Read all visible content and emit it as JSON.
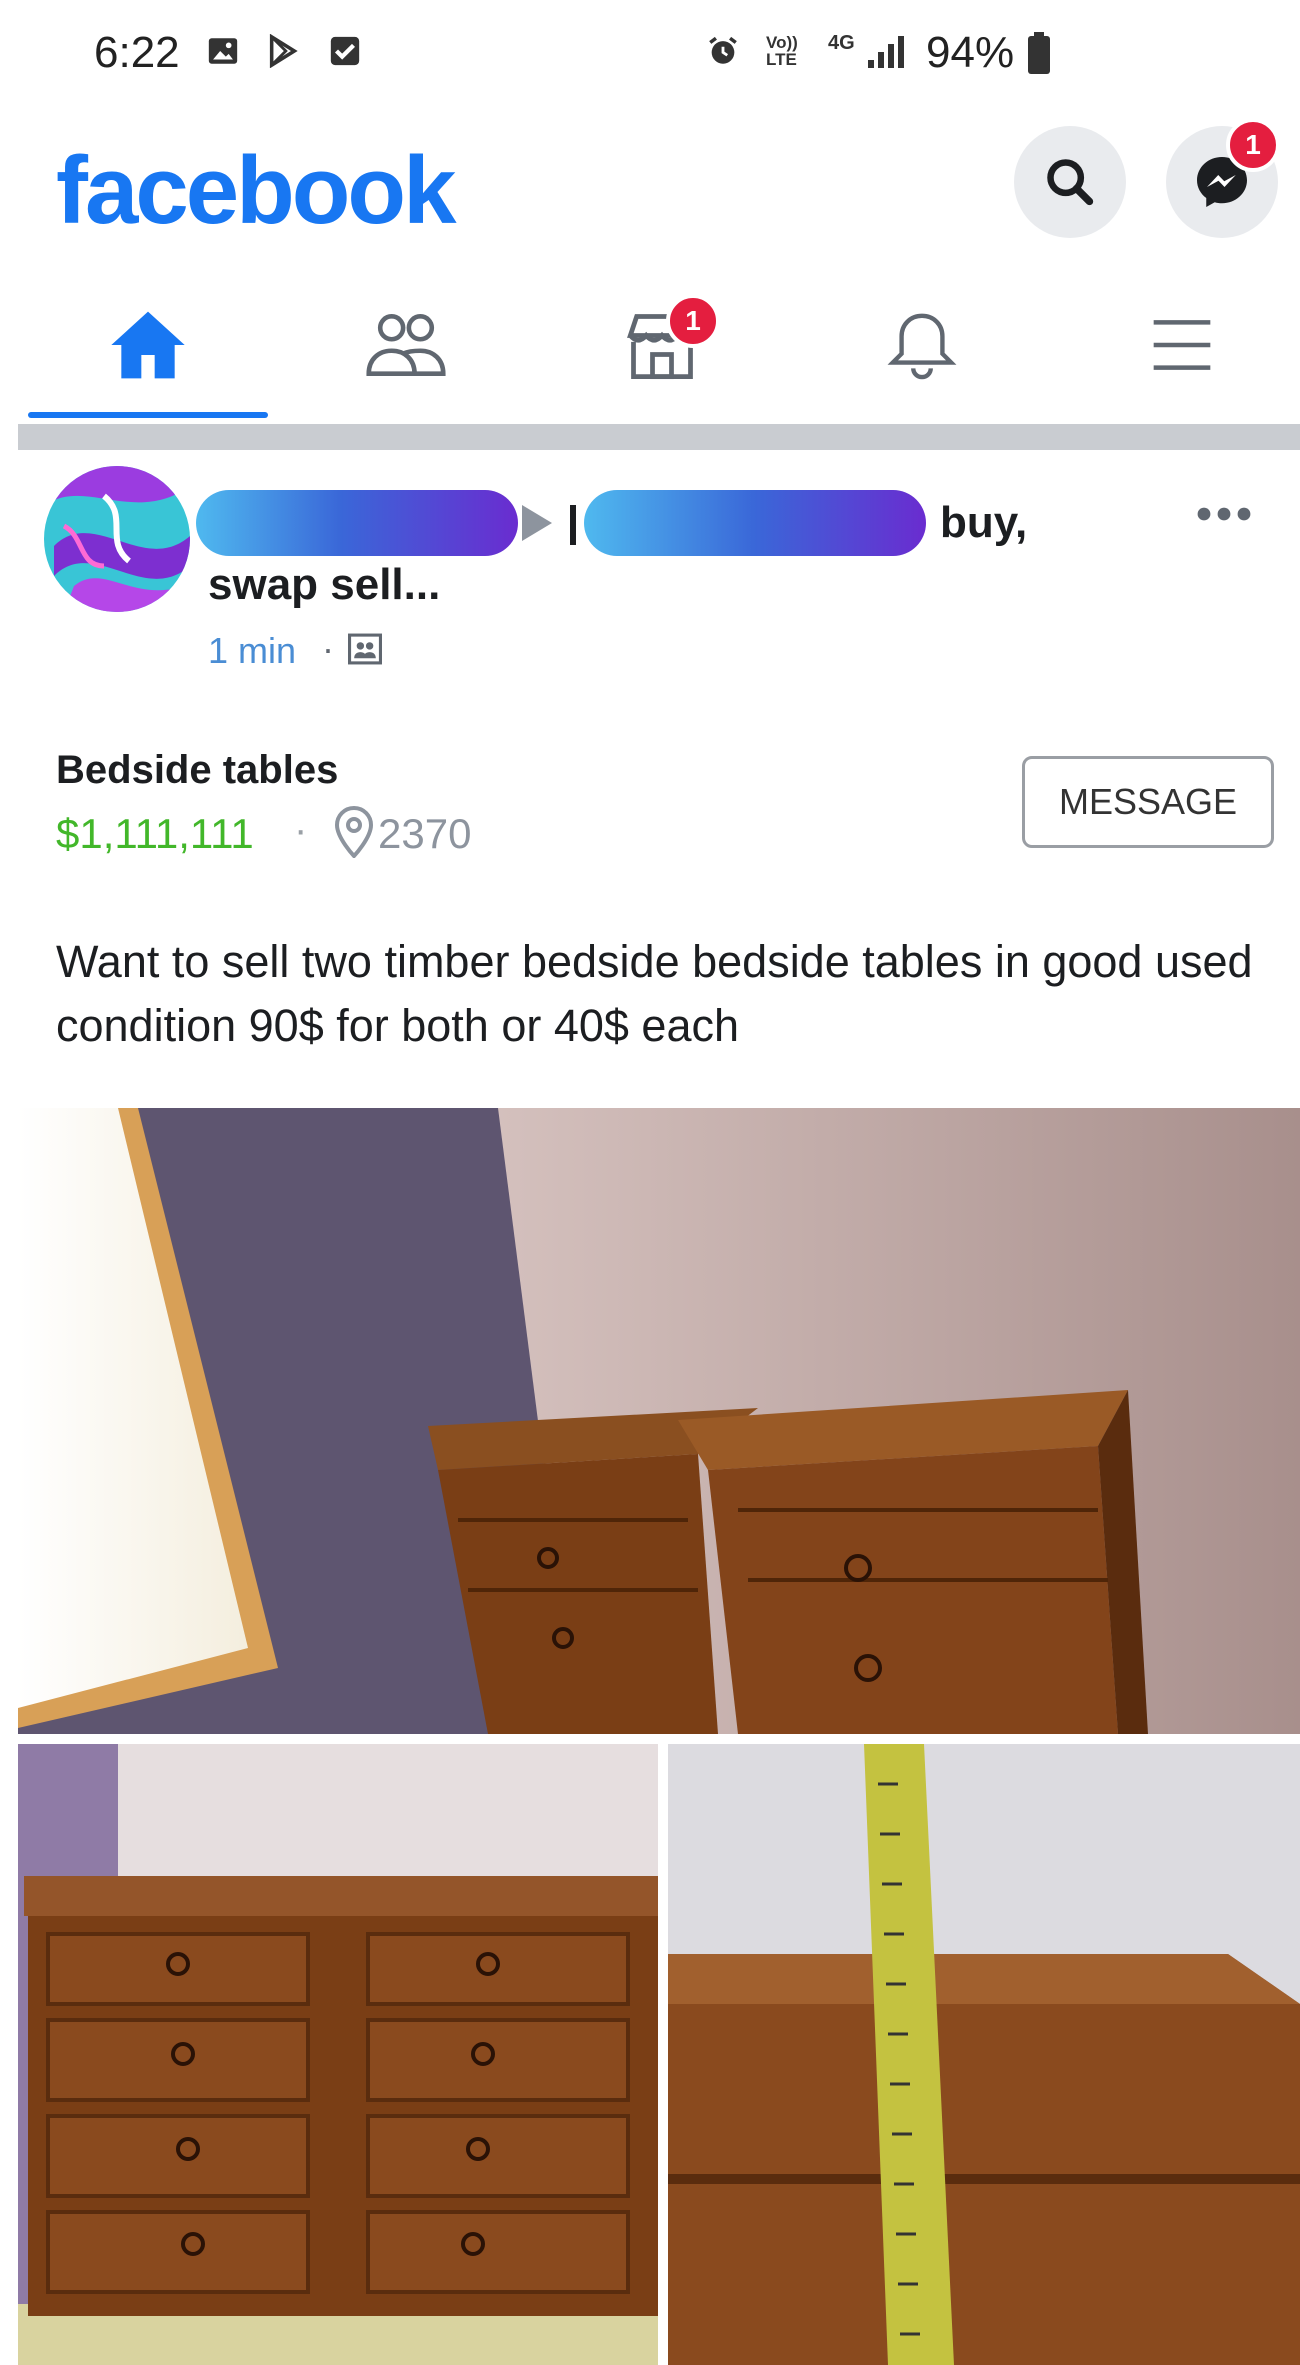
{
  "status_bar": {
    "time": "6:22",
    "network": "4G",
    "volte": "Vo)) LTE",
    "battery": "94%"
  },
  "header": {
    "logo": "facebook",
    "messenger_badge": "1"
  },
  "nav": {
    "marketplace_badge": "1"
  },
  "post": {
    "title_suffix": "buy,",
    "group_line2": "swap sell...",
    "time": "1 min",
    "separator": "·",
    "listing": {
      "title": "Bedside tables",
      "price": "$1,111,111",
      "dot": "·",
      "location": "2370",
      "message_button": "MESSAGE"
    },
    "description": "Want to sell two timber bedside  bedside tables in good used condition 90$ for both or 40$ each"
  },
  "colors": {
    "brand": "#1877f2",
    "badge": "#e41e3f",
    "price": "#42b72a"
  }
}
